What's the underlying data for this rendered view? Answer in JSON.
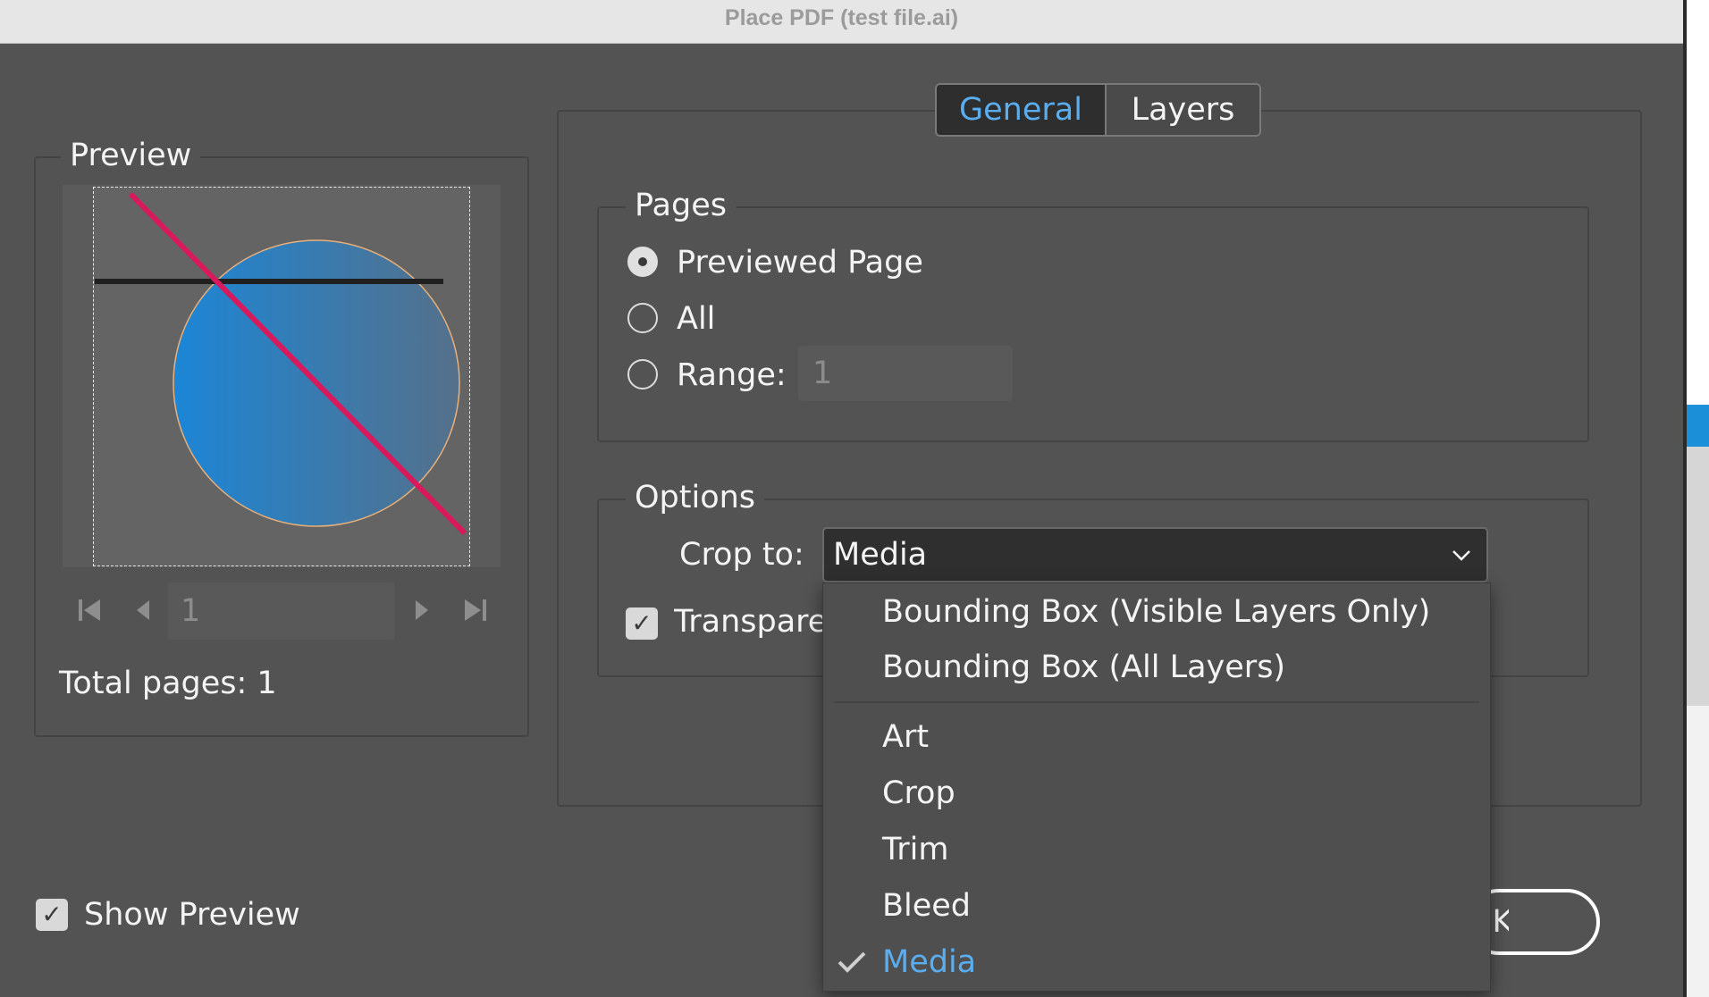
{
  "window": {
    "title": "Place PDF (test file.ai)"
  },
  "preview": {
    "group_label": "Preview",
    "page_number": "1",
    "total_pages_label": "Total pages: 1",
    "colors": {
      "circle_start": "#1c86d6",
      "circle_end": "#55708a",
      "diagonal_line": "#d81a5c",
      "horizontal_line": "#202020"
    }
  },
  "tabs": [
    {
      "label": "General",
      "active": true
    },
    {
      "label": "Layers",
      "active": false
    }
  ],
  "pages": {
    "group_label": "Pages",
    "options": [
      {
        "label": "Previewed Page",
        "selected": true
      },
      {
        "label": "All",
        "selected": false
      },
      {
        "label": "Range:",
        "selected": false
      }
    ],
    "range_value": "1"
  },
  "options": {
    "group_label": "Options",
    "crop_to_label": "Crop to:",
    "crop_to_value": "Media",
    "transparent_label": "Transparent Background",
    "transparent_checked": true
  },
  "dropdown": {
    "items_top": [
      "Bounding Box (Visible Layers Only)",
      "Bounding Box (All Layers)"
    ],
    "items_bottom": [
      "Art",
      "Crop",
      "Trim",
      "Bleed",
      "Media"
    ],
    "selected": "Media"
  },
  "show_preview": {
    "label": "Show Preview",
    "checked": true
  },
  "buttons": {
    "ok": "OK"
  },
  "accent_color": "#5aaef0"
}
